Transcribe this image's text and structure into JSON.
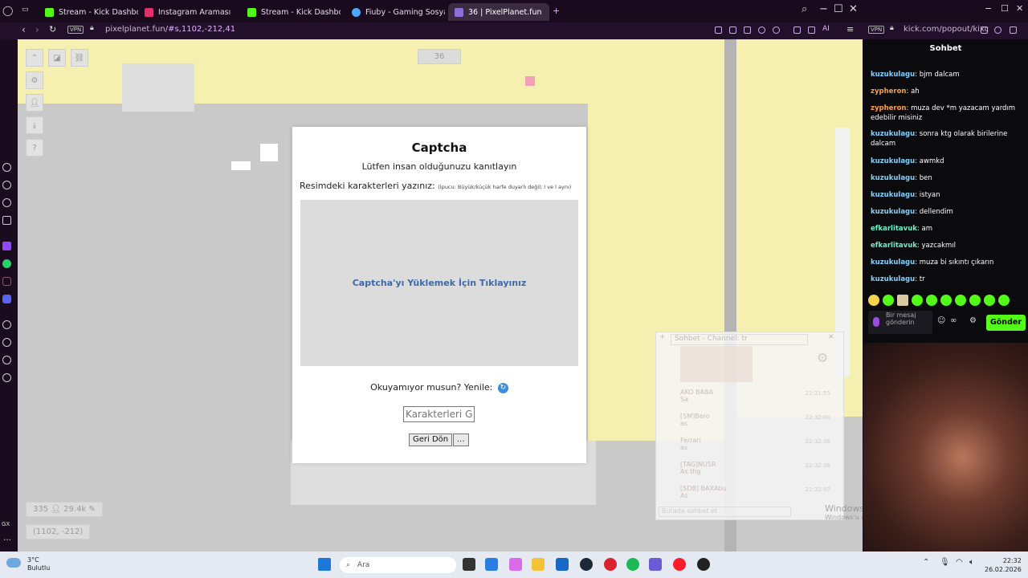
{
  "tabs": [
    {
      "label": "Stream - Kick Dashboard",
      "color": "#53fc18"
    },
    {
      "label": "Instagram Araması",
      "color": "#e1306c"
    },
    {
      "label": "Stream - Kick Dashboard",
      "color": "#53fc18"
    },
    {
      "label": "Fiuby - Gaming Sosyal Me",
      "color": "#4aa8ff"
    },
    {
      "label": "36 | PixelPlanet.fun",
      "color": "#8e6fd8"
    }
  ],
  "address": {
    "vpn": "VPN",
    "url_host": "pixelplanet.fun",
    "url_path": "/#s,1102,-212,41",
    "ai_label": "AI"
  },
  "address_right": {
    "vpn": "VPN",
    "url": "kick.com/popout/kixc"
  },
  "canvas": {
    "center_counter": "36",
    "online_count": "335",
    "pixel_count": "29.4k",
    "coords": "(1102, -212)"
  },
  "captcha": {
    "title": "Captcha",
    "subtitle": "Lütfen insan olduğunuzu kanıtlayın",
    "prompt": "Resimdeki karakterleri yazınız:",
    "prompt_hint": "(İpucu: Büyük/küçük harfe duyarlı değil; I ve l aynı)",
    "load_link": "Captcha'yı Yüklemek İçin Tıklayınız",
    "reload_text": "Okuyamıyor musun? Yenile:",
    "input_placeholder": "Karakterleri Gir",
    "back_button": "Geri Dön",
    "more_button": "..."
  },
  "ghost_chat": {
    "title": "Sohbet - Channel: tr",
    "rows": [
      {
        "name": "AKO BABA",
        "text": "Sa",
        "time": "22:31:55"
      },
      {
        "name": "[SM]Bero",
        "text": "as",
        "time": "22:32:00"
      },
      {
        "name": "Ferrari",
        "text": "as",
        "time": "22:32:06"
      },
      {
        "name": "[TAG]NUSR",
        "text": "As thg",
        "time": "22:32:06"
      },
      {
        "name": "[SDB] BAXAbu",
        "text": "As",
        "time": "22:32:07"
      }
    ],
    "input_placeholder": "Burada sohbet et"
  },
  "windows_activation": {
    "title": "Windows'u Etkinleştir",
    "sub": "Windows'u etkinleştirmek için Ayarlar'a gidin"
  },
  "chat": {
    "title": "Sohbet",
    "messages": [
      {
        "user": "kuzukulagu",
        "color": "#7fd1ff",
        "text": "bjm dalcam"
      },
      {
        "user": "zypheron",
        "color": "#ff9d3d",
        "text": "ah"
      },
      {
        "user": "zypheron",
        "color": "#ff9d3d",
        "text": "muza dev *m yazacam yardım edebilir misiniz"
      },
      {
        "user": "kuzukulagu",
        "color": "#7fd1ff",
        "text": "sonra ktg olarak birilerine dalcam"
      },
      {
        "user": "kuzukulagu",
        "color": "#7fd1ff",
        "text": "awmkd"
      },
      {
        "user": "kuzukulagu",
        "color": "#7fd1ff",
        "text": "ben"
      },
      {
        "user": "kuzukulagu",
        "color": "#7fd1ff",
        "text": "istyan"
      },
      {
        "user": "kuzukulagu",
        "color": "#7fd1ff",
        "text": "dellendim"
      },
      {
        "user": "efkarlitavuk",
        "color": "#6cf0c8",
        "text": "am"
      },
      {
        "user": "efkarlitavuk",
        "color": "#6cf0c8",
        "text": "yazcakmıl"
      },
      {
        "user": "kuzukulagu",
        "color": "#7fd1ff",
        "text": "muza bi sıkıntı çıkarın"
      },
      {
        "user": "kuzukulagu",
        "color": "#7fd1ff",
        "text": "tr"
      }
    ],
    "input_placeholder": "Bir mesaj gönderin",
    "send_button": "Gönder"
  },
  "taskbar": {
    "temp": "3°C",
    "weather": "Bulutlu",
    "search": "Ara",
    "time": "22:32",
    "date": "26.02.2026"
  }
}
